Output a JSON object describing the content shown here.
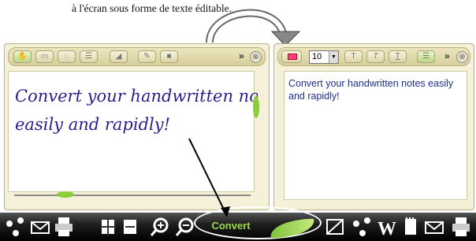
{
  "caption": "à l'écran sous forme de texte éditable.",
  "left_panel": {
    "handwriting_line1": "Convert your handwritten notes",
    "handwriting_line2": "easily and rapidly!",
    "more_label": "»",
    "close_label": "⊗"
  },
  "right_panel": {
    "font_size": "10",
    "bold_label": "T",
    "italic_label": "T",
    "underline_label": "T",
    "more_label": "»",
    "close_label": "⊗",
    "converted_text": "Convert your handwritten notes easily and rapidly!"
  },
  "bottom_bar": {
    "convert_label": "Convert"
  },
  "colors": {
    "panel_bg": "#f4f1d8",
    "converted_text": "#1e2f8e",
    "handwriting": "#2b1d8c",
    "leaf_green": "#8ccd3c",
    "swatch": "#ff3f78"
  }
}
